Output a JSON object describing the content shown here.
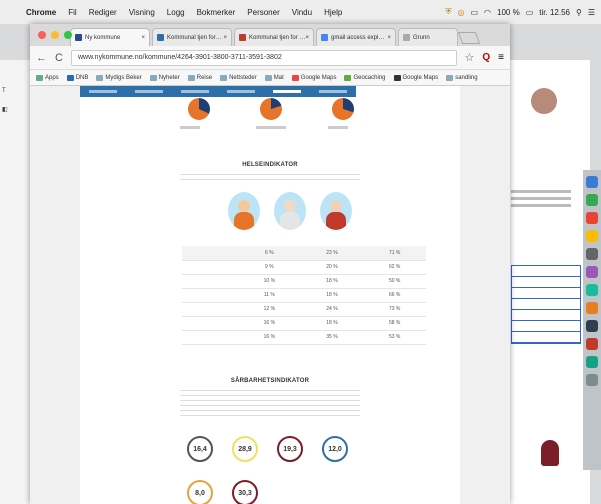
{
  "menubar": {
    "app": "Chrome",
    "items": [
      "Fil",
      "Rediger",
      "Visning",
      "Logg",
      "Bokmerker",
      "Personer",
      "Vindu",
      "Hjelp"
    ],
    "battery": "100 %",
    "clock": "tir. 12.56"
  },
  "tabs": [
    {
      "title": "Ny kommune",
      "color": "#2a4c8f"
    },
    {
      "title": "Kommunal tjen for…",
      "color": "#2f6fa8"
    },
    {
      "title": "Kommunal tjen for …",
      "color": "#c0392b"
    },
    {
      "title": "gmail access expl…",
      "color": "#4285f4"
    },
    {
      "title": "Grunn",
      "color": "#aaaaaa"
    }
  ],
  "toolbar": {
    "url": "www.nykommune.no/kommune/4264-3901-3800-3711-3591-3802",
    "back_icon": "←",
    "reload_icon": "C",
    "ext_label": "Q"
  },
  "bookmarks": [
    {
      "label": "Apps",
      "color": "#6a8"
    },
    {
      "label": "DNB",
      "color": "#2a6ab0"
    },
    {
      "label": "Mydigs Beker",
      "color": "#8ab"
    },
    {
      "label": "Nyheter",
      "color": "#8ab"
    },
    {
      "label": "Reise",
      "color": "#8ab"
    },
    {
      "label": "Nettsteder",
      "color": "#8ab"
    },
    {
      "label": "Mat",
      "color": "#8ab"
    },
    {
      "label": "Google Maps",
      "color": "#e44"
    },
    {
      "label": "Geocaching",
      "color": "#6a4"
    },
    {
      "label": "Google Maps",
      "color": "#333"
    },
    {
      "label": "sandling",
      "color": "#8ab"
    }
  ],
  "subnav": [
    "",
    "",
    "",
    "",
    "",
    ""
  ],
  "health": {
    "title": "HELSEINDIKATOR",
    "rows": [
      [
        "",
        "6 %",
        "23 %",
        "71 %"
      ],
      [
        "",
        "9 %",
        "20 %",
        "62 %"
      ],
      [
        "",
        "10 %",
        "18 %",
        "50 %"
      ],
      [
        "",
        "11 %",
        "18 %",
        "66 %"
      ],
      [
        "",
        "12 %",
        "24 %",
        "73 %"
      ],
      [
        "",
        "16 %",
        "18 %",
        "58 %"
      ],
      [
        "",
        "16 %",
        "35 %",
        "53 %"
      ]
    ]
  },
  "vulnerability": {
    "title": "SÅRBARHETSINDIKATOR",
    "circles": [
      {
        "value": "16,4",
        "color": "#555555"
      },
      {
        "value": "28,9",
        "color": "#f1e05a"
      },
      {
        "value": "19,3",
        "color": "#7b1e2a"
      },
      {
        "value": "12,0",
        "color": "#2f6fa8"
      },
      {
        "value": "8,0",
        "color": "#e6a23c"
      },
      {
        "value": "30,3",
        "color": "#7b1e2a"
      }
    ]
  },
  "colors": {
    "accent": "#2f6fa8",
    "pie_orange": "#e8742a",
    "pie_navy": "#1f3f73"
  }
}
